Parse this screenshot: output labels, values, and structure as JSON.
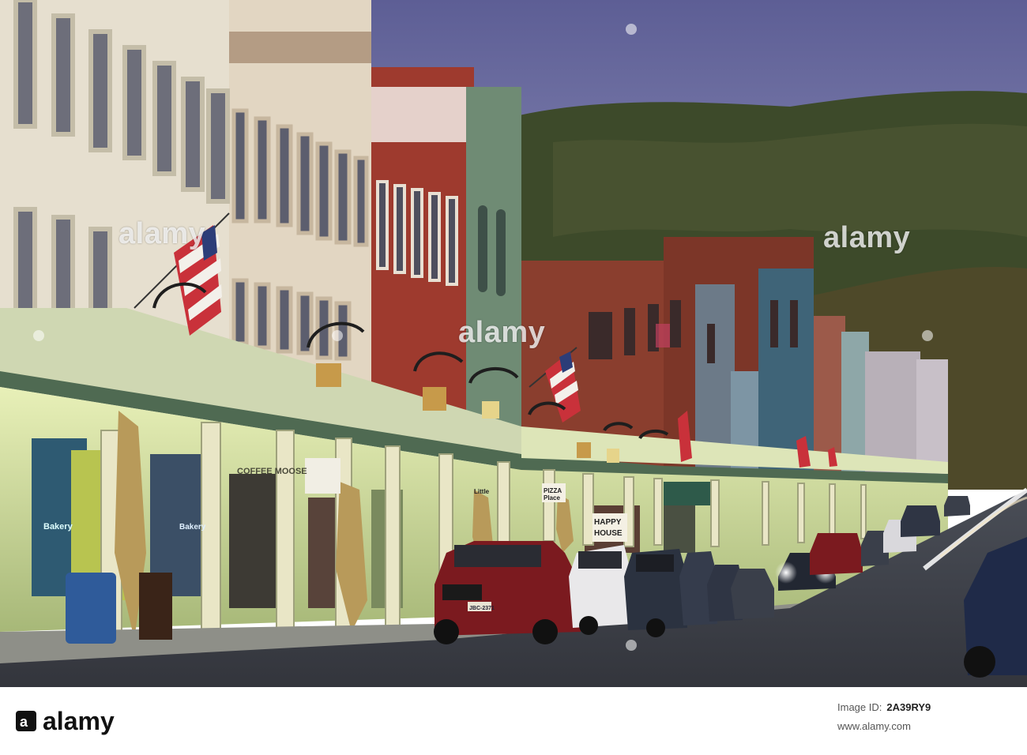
{
  "photo": {
    "description_hidden": "",
    "signs": {
      "coffee": "COFFEE MOOSE",
      "bakery": "Bakery",
      "happy": "HAPPY",
      "house": "HOUSE",
      "pizza": "PIZZA",
      "place": "Place",
      "little": "Little"
    },
    "plate": "JBC-2371"
  },
  "watermark": {
    "text": "alamy"
  },
  "footer": {
    "brand": "alamy",
    "image_id_label": "Image ID:",
    "image_id": "2A39RY9",
    "url": "www.alamy.com"
  },
  "colors": {
    "sky_top": "#5d5e95",
    "sky_bottom": "#9a9cc2",
    "hill": "#3d4a2a",
    "road": "#3c3f48",
    "storefront_glow": "#d9e8a8",
    "accent_brand": "#111111"
  }
}
